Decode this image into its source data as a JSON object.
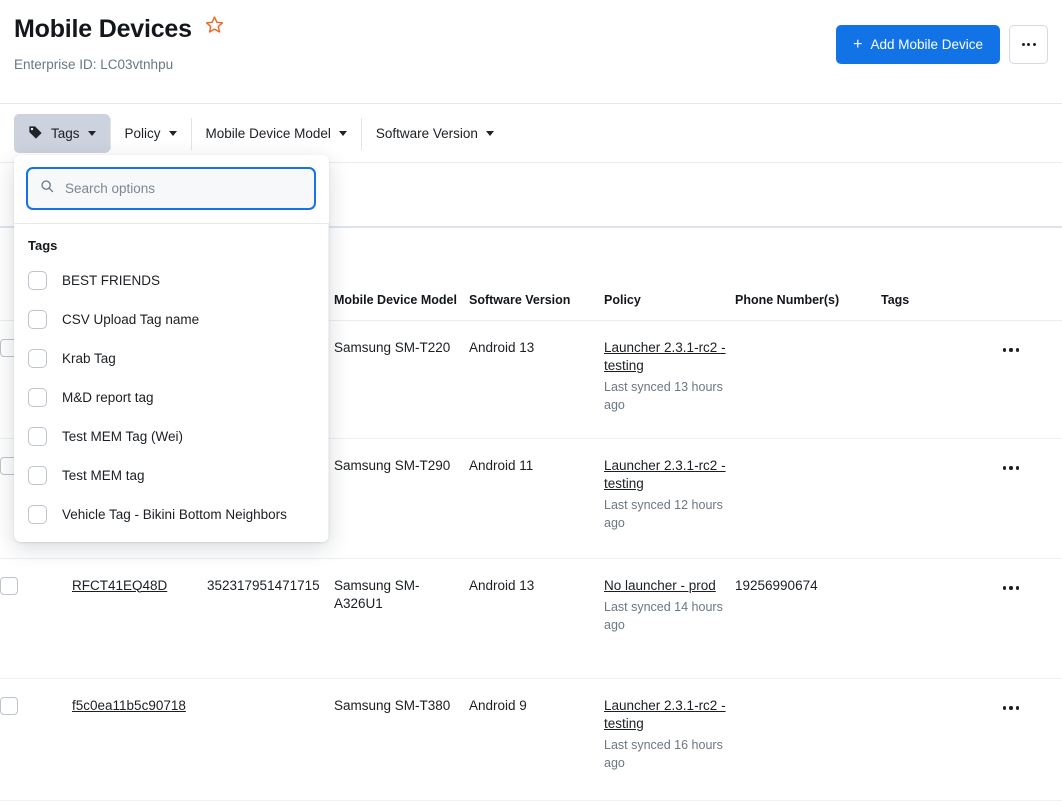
{
  "header": {
    "title": "Mobile Devices",
    "favorite_icon": "star-icon",
    "enterprise_label": "Enterprise ID: LC03vtnhpu",
    "add_button_label": "Add Mobile Device",
    "add_button_plus": "+",
    "overflow_icon": "ellipsis-icon",
    "accent_color": "#1273e6",
    "star_color": "#f06725"
  },
  "filters": [
    {
      "label": "Tags",
      "icon": "tag-icon",
      "active": true
    },
    {
      "label": "Policy",
      "icon": "chevron-down-icon",
      "active": false
    },
    {
      "label": "Mobile Device Model",
      "icon": "chevron-down-icon",
      "active": false
    },
    {
      "label": "Software Version",
      "icon": "chevron-down-icon",
      "active": false
    }
  ],
  "tags_dropdown": {
    "search": {
      "placeholder": "Search options",
      "value": "",
      "icon": "search-icon"
    },
    "group_label": "Tags",
    "options": [
      {
        "label": "BEST FRIENDS",
        "checked": false
      },
      {
        "label": "CSV Upload Tag name",
        "checked": false
      },
      {
        "label": "Krab Tag",
        "checked": false
      },
      {
        "label": "M&D report tag",
        "checked": false
      },
      {
        "label": "Test MEM Tag (Wei)",
        "checked": false
      },
      {
        "label": "Test MEM tag",
        "checked": false
      },
      {
        "label": "Vehicle Tag - Bikini Bottom Neighbors",
        "checked": false
      }
    ]
  },
  "table": {
    "columns": [
      {
        "key": "check",
        "label": ""
      },
      {
        "key": "serial",
        "label": ""
      },
      {
        "key": "imei",
        "label": ""
      },
      {
        "key": "model",
        "label": "Mobile Device Model"
      },
      {
        "key": "sw",
        "label": "Software Version"
      },
      {
        "key": "policy",
        "label": "Policy"
      },
      {
        "key": "phone",
        "label": "Phone Number(s)"
      },
      {
        "key": "tags",
        "label": "Tags"
      },
      {
        "key": "menu",
        "label": ""
      }
    ],
    "rows": [
      {
        "serial": "",
        "imei": "",
        "model": "Samsung SM-T220",
        "software": "Android 13",
        "policy": "Launcher 2.3.1-rc2 - testing",
        "last_synced": "Last synced 13 hours ago",
        "phone": "",
        "tags": "",
        "menu_icon": "ellipsis-icon"
      },
      {
        "serial": "",
        "imei": "",
        "model": "Samsung SM-T290",
        "software": "Android 11",
        "policy": "Launcher 2.3.1-rc2 - testing",
        "last_synced": "Last synced 12 hours ago",
        "phone": "",
        "tags": "",
        "menu_icon": "ellipsis-icon"
      },
      {
        "serial": "RFCT41EQ48D",
        "imei": "352317951471715",
        "model": "Samsung SM-A326U1",
        "software": "Android 13",
        "policy": "No launcher - prod",
        "last_synced": "Last synced 14 hours ago",
        "phone": "19256990674",
        "tags": "",
        "menu_icon": "ellipsis-icon"
      },
      {
        "serial": "f5c0ea11b5c90718",
        "imei": "",
        "model": "Samsung SM-T380",
        "software": "Android 9",
        "policy": "Launcher 2.3.1-rc2 - testing",
        "last_synced": "Last synced 16 hours ago",
        "phone": "",
        "tags": "",
        "menu_icon": "ellipsis-icon"
      }
    ]
  }
}
